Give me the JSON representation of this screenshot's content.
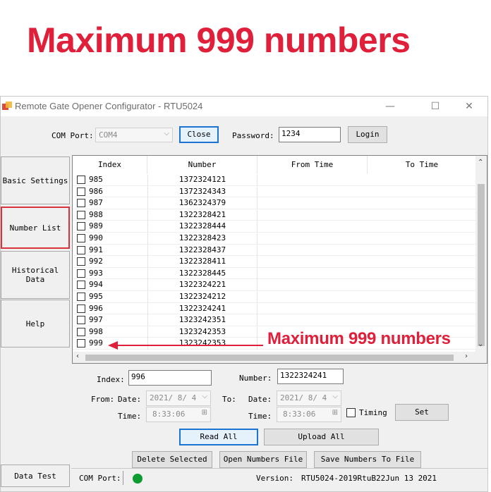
{
  "headline": "Maximum 999 numbers",
  "window": {
    "title": "Remote Gate Opener Configurator - RTU5024",
    "controls": {
      "minimize": "—",
      "maximize": "☐",
      "close": "✕"
    }
  },
  "top_bar": {
    "com_port_label": "COM Port:",
    "com_port_value": "COM4",
    "close_button": "Close",
    "password_label": "Password:",
    "password_value": "1234",
    "login_button": "Login"
  },
  "sidebar": {
    "basic_settings": "Basic Settings",
    "number_list": "Number List",
    "historical_data": "Historical\nData",
    "help": "Help",
    "data_test": "Data Test"
  },
  "grid": {
    "columns": [
      "Index",
      "Number",
      "From Time",
      "To Time"
    ],
    "rows": [
      {
        "index": "985",
        "number": "1372324121"
      },
      {
        "index": "986",
        "number": "1372324343"
      },
      {
        "index": "987",
        "number": "1362324379"
      },
      {
        "index": "988",
        "number": "1322328421"
      },
      {
        "index": "989",
        "number": "1322328444"
      },
      {
        "index": "990",
        "number": "1322328423"
      },
      {
        "index": "991",
        "number": "1322328437"
      },
      {
        "index": "992",
        "number": "1322328411"
      },
      {
        "index": "993",
        "number": "1322328445"
      },
      {
        "index": "994",
        "number": "1322324221"
      },
      {
        "index": "995",
        "number": "1322324212"
      },
      {
        "index": "996",
        "number": "1322324241"
      },
      {
        "index": "997",
        "number": "1323242351"
      },
      {
        "index": "998",
        "number": "1323242353"
      },
      {
        "index": "999",
        "number": "1323242353"
      }
    ]
  },
  "annotation": "Maximum 999 numbers",
  "form": {
    "index_label": "Index:",
    "index_value": "996",
    "number_label": "Number:",
    "number_value": "1322324241",
    "from_label": "From:",
    "date_label": "Date:",
    "from_date": "2021/ 8/ 4",
    "time_label": "Time:",
    "from_time": "8:33:06",
    "to_label": "To:",
    "to_date": "2021/ 8/ 4",
    "to_time": "8:33:06",
    "timing_label": "Timing",
    "set_button": "Set",
    "read_all_button": "Read All",
    "upload_all_button": "Upload All",
    "delete_selected_button": "Delete Selected",
    "open_numbers_file_button": "Open Numbers File",
    "save_numbers_button": "Save Numbers To File"
  },
  "status_bar": {
    "com_port_label": "COM Port:",
    "version_label": "Version:",
    "version_value": "RTU5024-2019RtuB22Jun 13 2021"
  },
  "colors": {
    "accent_red": "#e0203a",
    "status_green": "#0d9b32",
    "focus_blue": "#1c73d1"
  }
}
